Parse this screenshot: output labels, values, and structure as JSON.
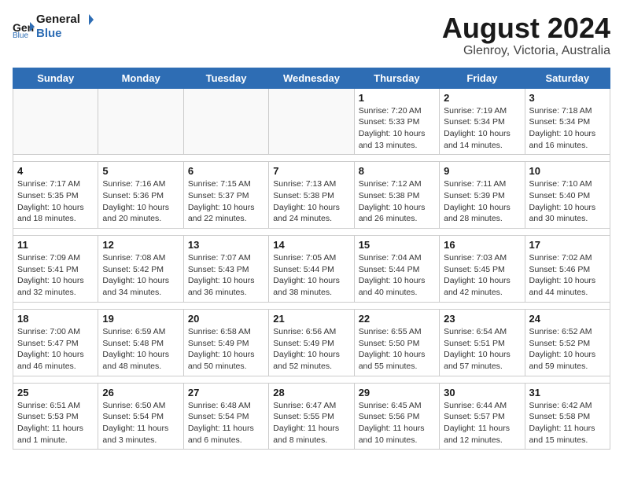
{
  "header": {
    "logo_line1": "General",
    "logo_line2": "Blue",
    "month": "August 2024",
    "location": "Glenroy, Victoria, Australia"
  },
  "weekdays": [
    "Sunday",
    "Monday",
    "Tuesday",
    "Wednesday",
    "Thursday",
    "Friday",
    "Saturday"
  ],
  "weeks": [
    [
      {
        "day": "",
        "info": ""
      },
      {
        "day": "",
        "info": ""
      },
      {
        "day": "",
        "info": ""
      },
      {
        "day": "",
        "info": ""
      },
      {
        "day": "1",
        "info": "Sunrise: 7:20 AM\nSunset: 5:33 PM\nDaylight: 10 hours\nand 13 minutes."
      },
      {
        "day": "2",
        "info": "Sunrise: 7:19 AM\nSunset: 5:34 PM\nDaylight: 10 hours\nand 14 minutes."
      },
      {
        "day": "3",
        "info": "Sunrise: 7:18 AM\nSunset: 5:34 PM\nDaylight: 10 hours\nand 16 minutes."
      }
    ],
    [
      {
        "day": "4",
        "info": "Sunrise: 7:17 AM\nSunset: 5:35 PM\nDaylight: 10 hours\nand 18 minutes."
      },
      {
        "day": "5",
        "info": "Sunrise: 7:16 AM\nSunset: 5:36 PM\nDaylight: 10 hours\nand 20 minutes."
      },
      {
        "day": "6",
        "info": "Sunrise: 7:15 AM\nSunset: 5:37 PM\nDaylight: 10 hours\nand 22 minutes."
      },
      {
        "day": "7",
        "info": "Sunrise: 7:13 AM\nSunset: 5:38 PM\nDaylight: 10 hours\nand 24 minutes."
      },
      {
        "day": "8",
        "info": "Sunrise: 7:12 AM\nSunset: 5:38 PM\nDaylight: 10 hours\nand 26 minutes."
      },
      {
        "day": "9",
        "info": "Sunrise: 7:11 AM\nSunset: 5:39 PM\nDaylight: 10 hours\nand 28 minutes."
      },
      {
        "day": "10",
        "info": "Sunrise: 7:10 AM\nSunset: 5:40 PM\nDaylight: 10 hours\nand 30 minutes."
      }
    ],
    [
      {
        "day": "11",
        "info": "Sunrise: 7:09 AM\nSunset: 5:41 PM\nDaylight: 10 hours\nand 32 minutes."
      },
      {
        "day": "12",
        "info": "Sunrise: 7:08 AM\nSunset: 5:42 PM\nDaylight: 10 hours\nand 34 minutes."
      },
      {
        "day": "13",
        "info": "Sunrise: 7:07 AM\nSunset: 5:43 PM\nDaylight: 10 hours\nand 36 minutes."
      },
      {
        "day": "14",
        "info": "Sunrise: 7:05 AM\nSunset: 5:44 PM\nDaylight: 10 hours\nand 38 minutes."
      },
      {
        "day": "15",
        "info": "Sunrise: 7:04 AM\nSunset: 5:44 PM\nDaylight: 10 hours\nand 40 minutes."
      },
      {
        "day": "16",
        "info": "Sunrise: 7:03 AM\nSunset: 5:45 PM\nDaylight: 10 hours\nand 42 minutes."
      },
      {
        "day": "17",
        "info": "Sunrise: 7:02 AM\nSunset: 5:46 PM\nDaylight: 10 hours\nand 44 minutes."
      }
    ],
    [
      {
        "day": "18",
        "info": "Sunrise: 7:00 AM\nSunset: 5:47 PM\nDaylight: 10 hours\nand 46 minutes."
      },
      {
        "day": "19",
        "info": "Sunrise: 6:59 AM\nSunset: 5:48 PM\nDaylight: 10 hours\nand 48 minutes."
      },
      {
        "day": "20",
        "info": "Sunrise: 6:58 AM\nSunset: 5:49 PM\nDaylight: 10 hours\nand 50 minutes."
      },
      {
        "day": "21",
        "info": "Sunrise: 6:56 AM\nSunset: 5:49 PM\nDaylight: 10 hours\nand 52 minutes."
      },
      {
        "day": "22",
        "info": "Sunrise: 6:55 AM\nSunset: 5:50 PM\nDaylight: 10 hours\nand 55 minutes."
      },
      {
        "day": "23",
        "info": "Sunrise: 6:54 AM\nSunset: 5:51 PM\nDaylight: 10 hours\nand 57 minutes."
      },
      {
        "day": "24",
        "info": "Sunrise: 6:52 AM\nSunset: 5:52 PM\nDaylight: 10 hours\nand 59 minutes."
      }
    ],
    [
      {
        "day": "25",
        "info": "Sunrise: 6:51 AM\nSunset: 5:53 PM\nDaylight: 11 hours\nand 1 minute."
      },
      {
        "day": "26",
        "info": "Sunrise: 6:50 AM\nSunset: 5:54 PM\nDaylight: 11 hours\nand 3 minutes."
      },
      {
        "day": "27",
        "info": "Sunrise: 6:48 AM\nSunset: 5:54 PM\nDaylight: 11 hours\nand 6 minutes."
      },
      {
        "day": "28",
        "info": "Sunrise: 6:47 AM\nSunset: 5:55 PM\nDaylight: 11 hours\nand 8 minutes."
      },
      {
        "day": "29",
        "info": "Sunrise: 6:45 AM\nSunset: 5:56 PM\nDaylight: 11 hours\nand 10 minutes."
      },
      {
        "day": "30",
        "info": "Sunrise: 6:44 AM\nSunset: 5:57 PM\nDaylight: 11 hours\nand 12 minutes."
      },
      {
        "day": "31",
        "info": "Sunrise: 6:42 AM\nSunset: 5:58 PM\nDaylight: 11 hours\nand 15 minutes."
      }
    ]
  ]
}
